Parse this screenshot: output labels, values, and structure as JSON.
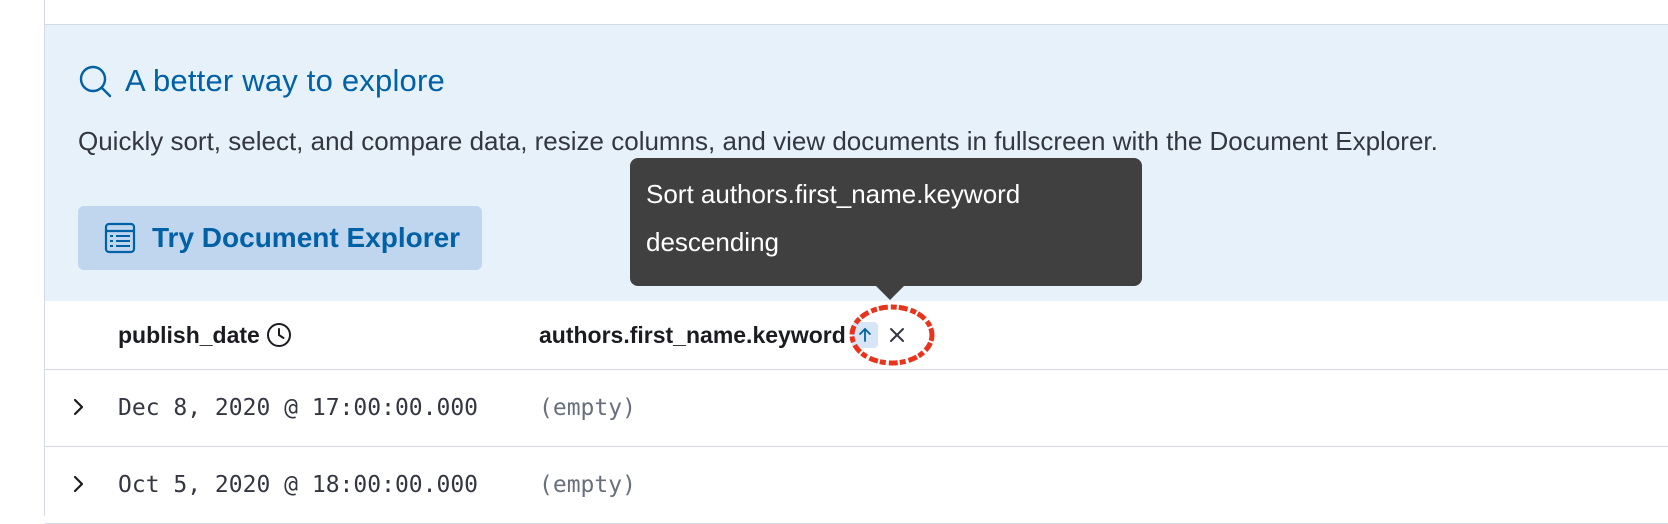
{
  "callout": {
    "title": "A better way to explore",
    "title_icon": "search-icon",
    "body": "Quickly sort, select, and compare data, resize columns, and view documents in fullscreen with the Document Explorer.",
    "button_label": "Try Document Explorer",
    "button_icon": "table-icon"
  },
  "table": {
    "columns": [
      {
        "label": "publish_date",
        "icon": "clock-icon"
      },
      {
        "label": "authors.first_name.keyword",
        "sort_icon": "sort-ascending-icon",
        "remove_icon": "close-icon"
      }
    ],
    "rows": [
      {
        "publish_date": "Dec 8, 2020 @ 17:00:00.000",
        "authors_first_name": "(empty)"
      },
      {
        "publish_date": "Oct 5, 2020 @ 18:00:00.000",
        "authors_first_name": "(empty)"
      }
    ]
  },
  "tooltip": {
    "line1": "Sort authors.first_name.keyword",
    "line2": "descending"
  },
  "colors": {
    "callout_bg": "#e6f1fa",
    "accent": "#0061a6",
    "button_bg": "#bfd6ee",
    "tooltip_bg": "#404040",
    "annotation_ring": "#e8341c"
  }
}
